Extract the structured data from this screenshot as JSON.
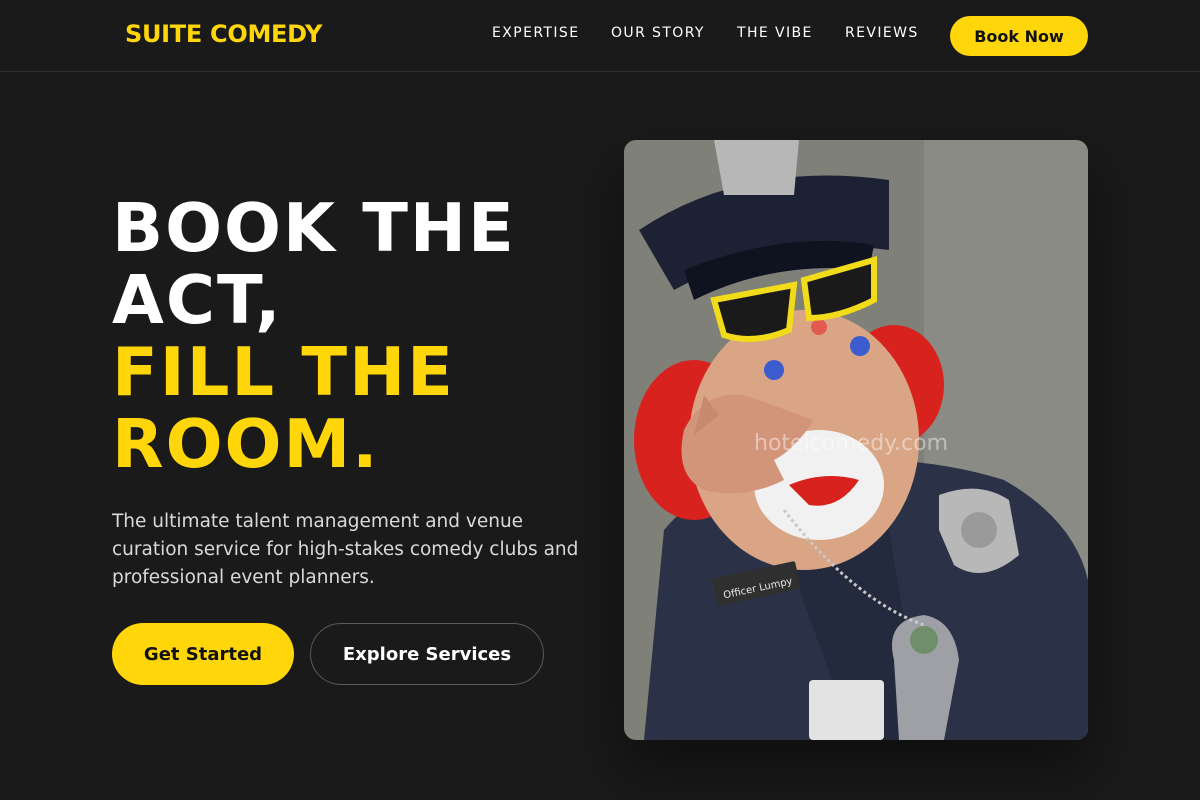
{
  "brand": {
    "name": "SUITE COMEDY",
    "accent": "#ffd60a",
    "background": "#1a1a1a"
  },
  "nav": {
    "items": [
      {
        "label": "EXPERTISE"
      },
      {
        "label": "OUR STORY"
      },
      {
        "label": "THE VIBE"
      },
      {
        "label": "REVIEWS"
      }
    ],
    "cta_label": "Book Now"
  },
  "hero": {
    "headline_white": "BOOK THE ACT,",
    "headline_yellow": "FILL THE ROOM.",
    "description": "The ultimate talent management and venue curation service for high-stakes comedy clubs and professional event planners.",
    "primary_cta": "Get Started",
    "secondary_cta": "Explore Services"
  },
  "photo": {
    "watermark": "hotelcomedy.com",
    "name_tag": "Officer Lumpy"
  }
}
